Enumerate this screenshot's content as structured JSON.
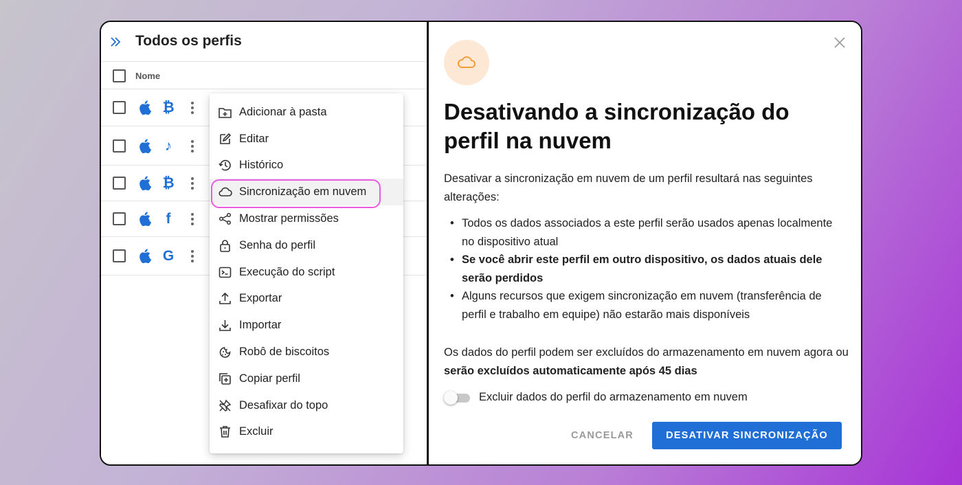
{
  "left_panel": {
    "title": "Todos os perfis",
    "column_header": "Nome",
    "rows": [
      {
        "os_icon": "apple-icon",
        "brand_icon": "bitcoin-icon",
        "brand_glyph": "₿"
      },
      {
        "os_icon": "apple-icon",
        "brand_icon": "tiktok-icon",
        "brand_glyph": "♪"
      },
      {
        "os_icon": "apple-icon",
        "brand_icon": "bitcoin-icon",
        "brand_glyph": "₿"
      },
      {
        "os_icon": "apple-icon",
        "brand_icon": "facebook-icon",
        "brand_glyph": "f"
      },
      {
        "os_icon": "apple-icon",
        "brand_icon": "google-icon",
        "brand_glyph": "G"
      }
    ]
  },
  "context_menu": {
    "items": [
      {
        "label": "Adicionar à pasta",
        "icon": "folder-plus-icon"
      },
      {
        "label": "Editar",
        "icon": "edit-icon"
      },
      {
        "label": "Histórico",
        "icon": "history-icon"
      },
      {
        "label": "Sincronização em nuvem",
        "icon": "cloud-icon",
        "active": true
      },
      {
        "label": "Mostrar permissões",
        "icon": "share-icon"
      },
      {
        "label": "Senha do perfil",
        "icon": "lock-icon"
      },
      {
        "label": "Execução do script",
        "icon": "terminal-icon"
      },
      {
        "label": "Exportar",
        "icon": "upload-icon"
      },
      {
        "label": "Importar",
        "icon": "download-icon"
      },
      {
        "label": "Robô de biscoitos",
        "icon": "cookie-icon"
      },
      {
        "label": "Copiar perfil",
        "icon": "copy-icon"
      },
      {
        "label": "Desafixar do topo",
        "icon": "unpin-icon"
      },
      {
        "label": "Excluir",
        "icon": "trash-icon"
      }
    ]
  },
  "dialog": {
    "title": "Desativando a sincronização do perfil na nuvem",
    "intro": "Desativar a sincronização em nuvem de um perfil resultará nas seguintes alterações:",
    "bullets": [
      {
        "text": "Todos os dados associados a este perfil serão usados apenas localmente no dispositivo atual",
        "bold": false
      },
      {
        "text": "Se você abrir este perfil em outro dispositivo, os dados atuais dele serão perdidos",
        "bold": true
      },
      {
        "text": "Alguns recursos que exigem sincronização em nuvem (transferência de perfil e trabalho em equipe) não estarão mais disponíveis",
        "bold": false
      }
    ],
    "note_prefix": "Os dados do perfil podem ser excluídos do armazenamento em nuvem agora ou ",
    "note_bold": "serão excluídos automaticamente após 45 dias",
    "toggle_label": "Excluir dados do perfil do armazenamento em nuvem",
    "toggle_on": false,
    "cancel_label": "CANCELAR",
    "confirm_label": "DESATIVAR SINCRONIZAÇÃO"
  },
  "colors": {
    "accent": "#1f6fd6",
    "highlight_border": "#e85be0",
    "cloud_badge_bg": "#fde8d5",
    "cloud_icon": "#f29d38"
  }
}
